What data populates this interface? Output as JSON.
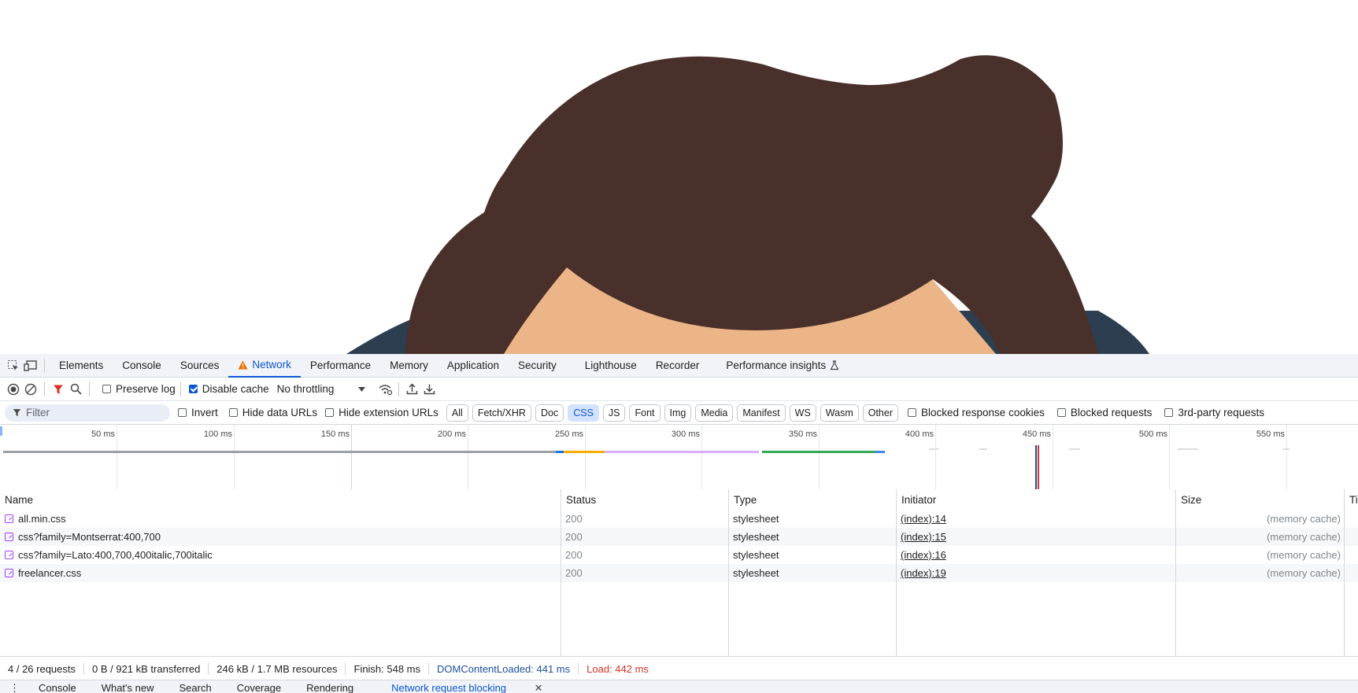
{
  "devtools": {
    "tabs": [
      "Elements",
      "Console",
      "Sources",
      "Network",
      "Performance",
      "Memory",
      "Application",
      "Security",
      "Lighthouse",
      "Recorder",
      "Performance insights"
    ],
    "active_tab": "Network",
    "toolbar": {
      "preserve_log": "Preserve log",
      "disable_cache": "Disable cache",
      "throttling": "No throttling"
    },
    "filter": {
      "placeholder": "Filter",
      "invert": "Invert",
      "hide_data_urls": "Hide data URLs",
      "hide_extension_urls": "Hide extension URLs",
      "types": [
        "All",
        "Fetch/XHR",
        "Doc",
        "CSS",
        "JS",
        "Font",
        "Img",
        "Media",
        "Manifest",
        "WS",
        "Wasm",
        "Other"
      ],
      "active_type": "CSS",
      "blocked_response_cookies": "Blocked response cookies",
      "blocked_requests": "Blocked requests",
      "third_party": "3rd-party requests"
    },
    "timeline": {
      "labels": [
        "50 ms",
        "100 ms",
        "150 ms",
        "200 ms",
        "250 ms",
        "300 ms",
        "350 ms",
        "400 ms",
        "450 ms",
        "500 ms",
        "550 ms"
      ]
    },
    "table": {
      "columns": [
        "Name",
        "Status",
        "Type",
        "Initiator",
        "Size",
        "Ti"
      ],
      "rows": [
        {
          "name": "all.min.css",
          "status": "200",
          "type": "stylesheet",
          "initiator": "(index):14",
          "size": "(memory cache)"
        },
        {
          "name": "css?family=Montserrat:400,700",
          "status": "200",
          "type": "stylesheet",
          "initiator": "(index):15",
          "size": "(memory cache)"
        },
        {
          "name": "css?family=Lato:400,700,400italic,700italic",
          "status": "200",
          "type": "stylesheet",
          "initiator": "(index):16",
          "size": "(memory cache)"
        },
        {
          "name": "freelancer.css",
          "status": "200",
          "type": "stylesheet",
          "initiator": "(index):19",
          "size": "(memory cache)"
        }
      ]
    },
    "status_bar": {
      "requests": "4 / 26 requests",
      "transferred": "0 B / 921 kB transferred",
      "resources": "246 kB / 1.7 MB resources",
      "finish": "Finish: 548 ms",
      "dom_content_loaded": "DOMContentLoaded: 441 ms",
      "load": "Load: 442 ms"
    },
    "drawer_tabs": [
      "Console",
      "What's new",
      "Search",
      "Coverage",
      "Rendering",
      "Network request blocking"
    ],
    "drawer_active": "Network request blocking"
  },
  "colors": {
    "hair": "#4a302a",
    "skin": "#ecb588",
    "shirt": "#2c3e50",
    "accent": "#0b57d0",
    "load_red": "#d93025",
    "dcl_blue": "#1a4fa0"
  }
}
